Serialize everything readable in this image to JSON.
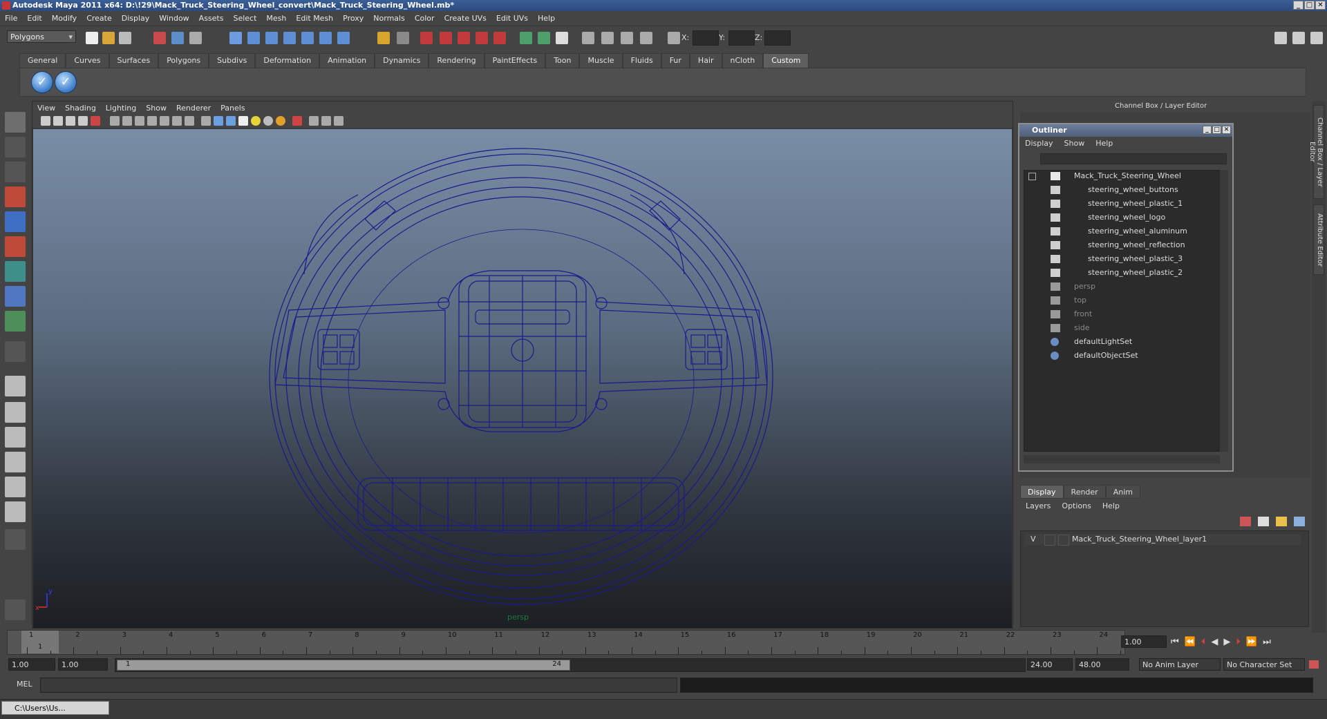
{
  "window": {
    "title": "Autodesk Maya 2011 x64: D:\\!29\\Mack_Truck_Steering_Wheel_convert\\Mack_Truck_Steering_Wheel.mb*",
    "min": "_",
    "max": "□",
    "close": "✕"
  },
  "menubar": [
    "File",
    "Edit",
    "Modify",
    "Create",
    "Display",
    "Window",
    "Assets",
    "Select",
    "Mesh",
    "Edit Mesh",
    "Proxy",
    "Normals",
    "Color",
    "Create UVs",
    "Edit UVs",
    "Help"
  ],
  "status": {
    "mode": "Polygons",
    "x_label": "X:",
    "y_label": "Y:",
    "z_label": "Z:"
  },
  "shelf": {
    "tabs": [
      "General",
      "Curves",
      "Surfaces",
      "Polygons",
      "Subdivs",
      "Deformation",
      "Animation",
      "Dynamics",
      "Rendering",
      "PaintEffects",
      "Toon",
      "Muscle",
      "Fluids",
      "Fur",
      "Hair",
      "nCloth",
      "Custom"
    ],
    "active_tab": "Custom",
    "check_icon": "✓"
  },
  "viewport": {
    "menu": [
      "View",
      "Shading",
      "Lighting",
      "Show",
      "Renderer",
      "Panels"
    ],
    "camera": "persp",
    "axis_x": "x",
    "axis_y": "y"
  },
  "channel_box": {
    "title": "Channel Box / Layer Editor"
  },
  "side_tabs": [
    "Channel Box / Layer Editor",
    "Attribute Editor"
  ],
  "outliner": {
    "title": "Outliner",
    "menu": [
      "Display",
      "Show",
      "Help"
    ],
    "items": [
      {
        "label": "Mack_Truck_Steering_Wheel",
        "type": "root"
      },
      {
        "label": "steering_wheel_buttons",
        "type": "child"
      },
      {
        "label": "steering_wheel_plastic_1",
        "type": "child"
      },
      {
        "label": "steering_wheel_logo",
        "type": "child"
      },
      {
        "label": "steering_wheel_aluminum",
        "type": "child"
      },
      {
        "label": "steering_wheel_reflection",
        "type": "child"
      },
      {
        "label": "steering_wheel_plastic_3",
        "type": "child"
      },
      {
        "label": "steering_wheel_plastic_2",
        "type": "child"
      },
      {
        "label": "persp",
        "type": "camera"
      },
      {
        "label": "top",
        "type": "camera"
      },
      {
        "label": "front",
        "type": "camera"
      },
      {
        "label": "side",
        "type": "camera"
      },
      {
        "label": "defaultLightSet",
        "type": "set"
      },
      {
        "label": "defaultObjectSet",
        "type": "set"
      }
    ]
  },
  "layer_editor": {
    "tabs": [
      "Display",
      "Render",
      "Anim"
    ],
    "active_tab": "Display",
    "menu": [
      "Layers",
      "Options",
      "Help"
    ],
    "layer": {
      "visible": "V",
      "name": "Mack_Truck_Steering_Wheel_layer1"
    }
  },
  "timeline": {
    "ticks": [
      "1",
      "2",
      "3",
      "4",
      "5",
      "6",
      "7",
      "8",
      "9",
      "10",
      "11",
      "12",
      "13",
      "14",
      "15",
      "16",
      "17",
      "18",
      "19",
      "20",
      "21",
      "22",
      "23",
      "24"
    ],
    "current_frame_marker": "1",
    "current_time": "1.00"
  },
  "range": {
    "start": "1.00",
    "playback_start": "1.00",
    "handle_start": "1",
    "handle_end": "24",
    "playback_end": "24.00",
    "end": "48.00",
    "anim_layer": "No Anim Layer",
    "character_set": "No Character Set"
  },
  "command": {
    "label": "MEL"
  },
  "taskbar": {
    "item": "C:\\Users\\Us..."
  }
}
